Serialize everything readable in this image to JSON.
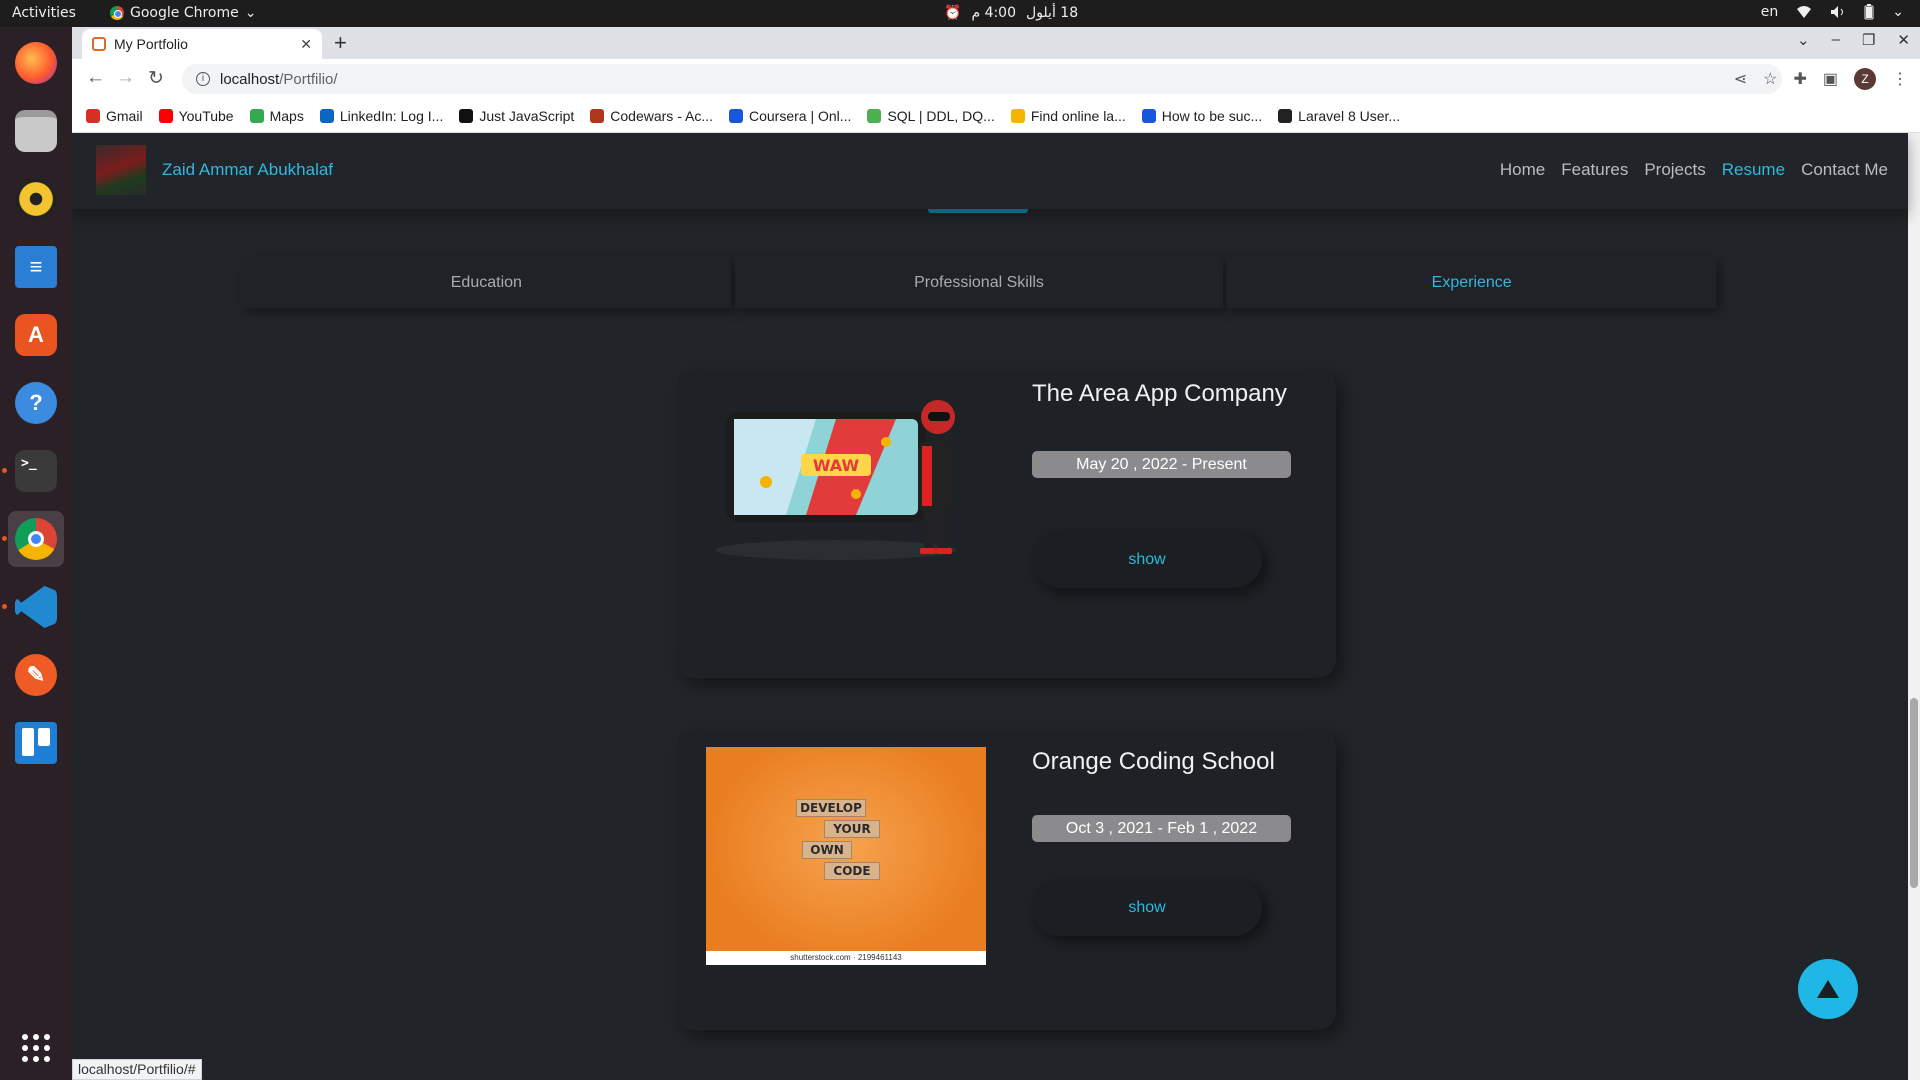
{
  "system_bar": {
    "activities": "Activities",
    "app_name": "Google Chrome",
    "clock_time": "4:00 م",
    "clock_date": "18 أيلول",
    "lang": "en"
  },
  "dock": [
    "firefox",
    "files",
    "rhythmbox",
    "libreoffice-writer",
    "software-center",
    "help",
    "terminal",
    "chrome",
    "vscode",
    "postman",
    "trello",
    "app-grid"
  ],
  "browser": {
    "tab_title": "My Portfolio",
    "url_host": "localhost",
    "url_path": "/Portfilio/",
    "bookmarks": [
      "Gmail",
      "YouTube",
      "Maps",
      "LinkedIn: Log I...",
      "Just JavaScript",
      "Codewars - Ac...",
      "Coursera | Onl...",
      "SQL | DDL, DQ...",
      "Find online la...",
      "How to be suc...",
      "Laravel 8 User..."
    ],
    "bookmark_colors": [
      "#d93025",
      "#ff0000",
      "#34a853",
      "#0a66c2",
      "#111111",
      "#b1361e",
      "#1a56db",
      "#4caf50",
      "#f4b400",
      "#1a56db",
      "#222222"
    ],
    "profile_initial": "Z",
    "status_url": "localhost/Portfilio/#"
  },
  "site": {
    "brand_name": "Zaid Ammar Abukhalaf",
    "nav": [
      "Home",
      "Features",
      "Projects",
      "Resume",
      "Contact Me"
    ],
    "nav_active": "Resume",
    "accent_color": "#2fb8e0",
    "resume_tabs": [
      "Education",
      "Professional Skills",
      "Experience"
    ],
    "resume_tab_active": "Experience",
    "experience": [
      {
        "company": "The Area App Company",
        "dates": "May 20 , 2022 - Present",
        "button": "show",
        "image": "phone-game-illustration"
      },
      {
        "company": "Orange Coding School",
        "dates": "Oct 3 , 2021 - Feb 1 , 2022",
        "button": "show",
        "image": "develop-your-own-code-blocks"
      }
    ],
    "blocks_text": [
      "DEVELOP",
      "YOUR",
      "OWN",
      "CODE"
    ],
    "image_credit": "shutterstock.com · 2199461143"
  }
}
